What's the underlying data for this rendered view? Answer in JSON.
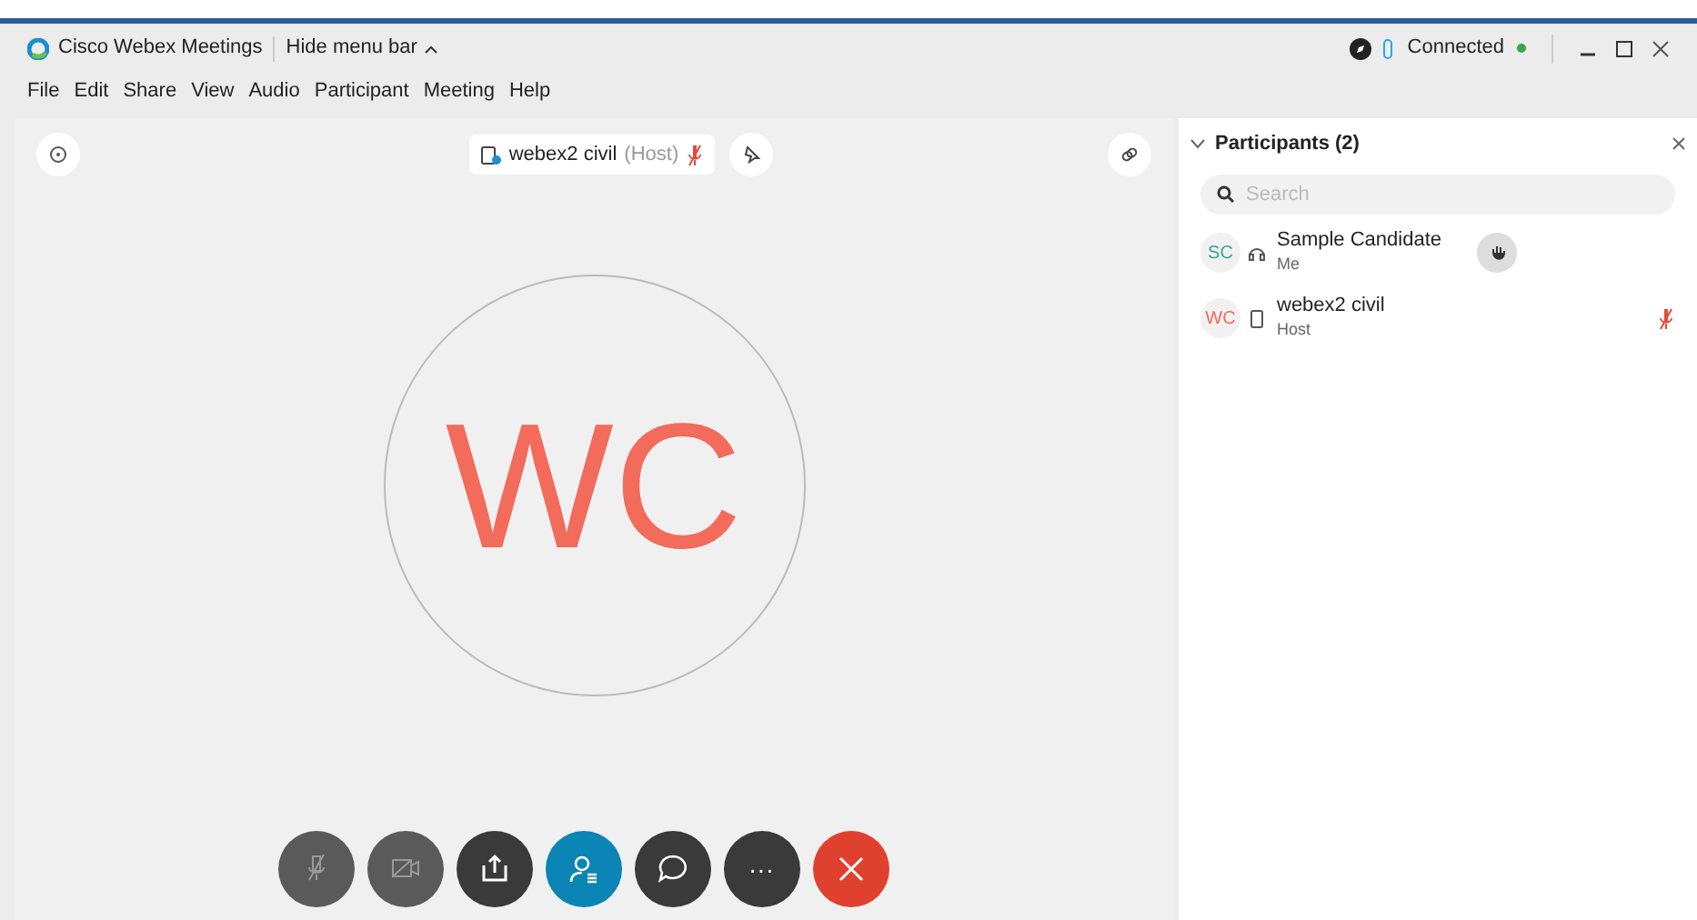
{
  "window": {
    "title": "Cisco Webex Meetings",
    "menu_toggle": "Hide menu bar",
    "status": "Connected",
    "connected": true
  },
  "menu": [
    "File",
    "Edit",
    "Share",
    "View",
    "Audio",
    "Participant",
    "Meeting",
    "Help"
  ],
  "stage": {
    "speaker": "webex2 civil",
    "role": "(Host)",
    "muted": true,
    "initials": "WC"
  },
  "participants_panel": {
    "title": "Participants (2)",
    "expanded": true,
    "search": {
      "placeholder": "Search"
    },
    "participants": [
      {
        "initials": "SC",
        "name": "Sample Candidate",
        "role": "Me",
        "color": "#3aa58f",
        "kind": "headset",
        "hand_raised": true,
        "muted": false
      },
      {
        "initials": "WC",
        "name": "webex2 civil",
        "role": "Host",
        "color": "#f26b5b",
        "kind": "phone",
        "hand_raised": false,
        "muted": true
      }
    ]
  },
  "controls": [
    {
      "kind": "mute",
      "selected": false
    },
    {
      "kind": "video",
      "selected": false
    },
    {
      "kind": "share",
      "selected": false
    },
    {
      "kind": "participants",
      "selected": true
    },
    {
      "kind": "chat",
      "selected": false
    },
    {
      "kind": "more",
      "label": "···",
      "selected": false
    },
    {
      "kind": "end",
      "selected": false
    }
  ]
}
